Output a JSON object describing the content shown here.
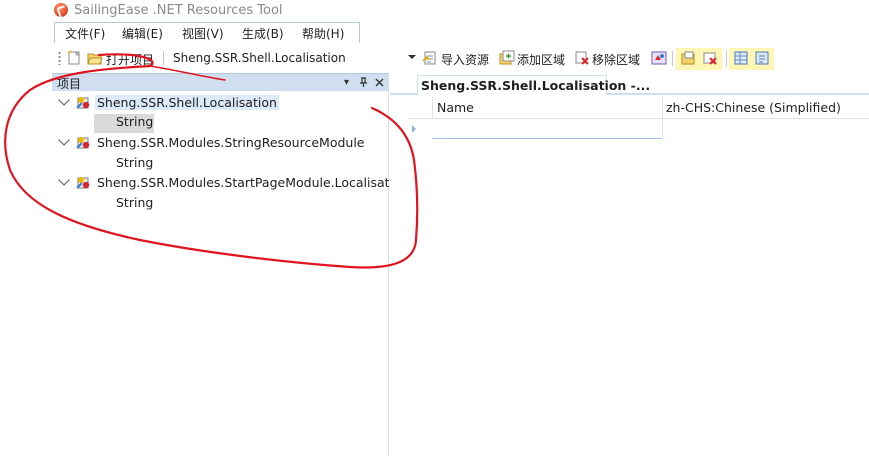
{
  "window": {
    "title": "SailingEase .NET Resources Tool"
  },
  "menu": {
    "items": [
      {
        "label": "文件(F)"
      },
      {
        "label": "编辑(E)"
      },
      {
        "label": "视图(V)"
      },
      {
        "label": "生成(B)"
      },
      {
        "label": "帮助(H)"
      }
    ]
  },
  "toolbar": {
    "open_project_label": "打开项目",
    "project_selected": "Sheng.SSR.Shell.Localisation",
    "import_label": "导入资源",
    "add_region_label": "添加区域",
    "remove_region_label": "移除区域"
  },
  "panel": {
    "title": "项目",
    "pin_glyph": "⬝",
    "close_glyph": "✕",
    "dropdown_glyph": "▾"
  },
  "tree": {
    "nodes": [
      {
        "label": "Sheng.SSR.Shell.Localisation",
        "children": [
          {
            "label": "String"
          }
        ]
      },
      {
        "label": "Sheng.SSR.Modules.StringResourceModule",
        "children": [
          {
            "label": "String"
          }
        ]
      },
      {
        "label": "Sheng.SSR.Modules.StartPageModule.Localisatior",
        "children": [
          {
            "label": "String"
          }
        ]
      }
    ]
  },
  "document": {
    "tab_label": "Sheng.SSR.Shell.Localisation -...",
    "columns": [
      {
        "label": "Name"
      },
      {
        "label": "zh-CHS:Chinese (Simplified)"
      }
    ]
  },
  "colors": {
    "panel_header": "#cfdff0",
    "annotation": "#e0141e",
    "selection_gray": "#d9d9d9"
  }
}
